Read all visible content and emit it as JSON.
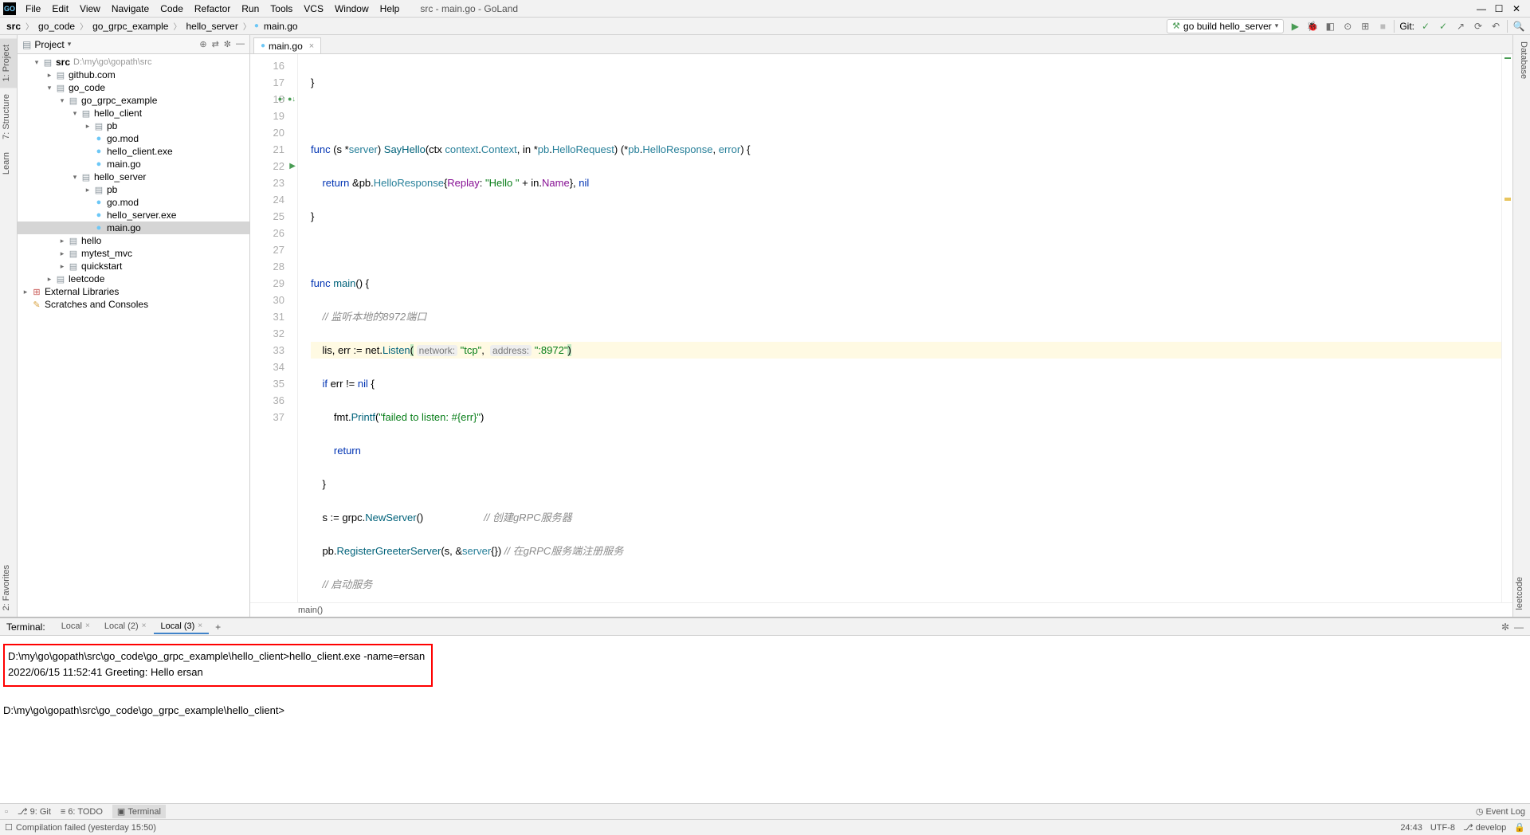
{
  "window": {
    "title": "src - main.go - GoLand"
  },
  "menu": [
    "File",
    "Edit",
    "View",
    "Navigate",
    "Code",
    "Refactor",
    "Run",
    "Tools",
    "VCS",
    "Window",
    "Help"
  ],
  "breadcrumbs": [
    "src",
    "go_code",
    "go_grpc_example",
    "hello_server",
    "main.go"
  ],
  "run_config": {
    "label": "go build hello_server"
  },
  "git_label": "Git:",
  "project": {
    "title": "Project",
    "tree": {
      "root": {
        "label": "src",
        "path": "D:\\my\\go\\gopath\\src"
      },
      "items": [
        {
          "label": "github.com",
          "indent": 2,
          "arrow": "▸",
          "icon": "folder"
        },
        {
          "label": "go_code",
          "indent": 2,
          "arrow": "▾",
          "icon": "folder"
        },
        {
          "label": "go_grpc_example",
          "indent": 3,
          "arrow": "▾",
          "icon": "folder"
        },
        {
          "label": "hello_client",
          "indent": 4,
          "arrow": "▾",
          "icon": "folder"
        },
        {
          "label": "pb",
          "indent": 5,
          "arrow": "▸",
          "icon": "folder"
        },
        {
          "label": "go.mod",
          "indent": 5,
          "arrow": "",
          "icon": "go"
        },
        {
          "label": "hello_client.exe",
          "indent": 5,
          "arrow": "",
          "icon": "go"
        },
        {
          "label": "main.go",
          "indent": 5,
          "arrow": "",
          "icon": "go"
        },
        {
          "label": "hello_server",
          "indent": 4,
          "arrow": "▾",
          "icon": "folder"
        },
        {
          "label": "pb",
          "indent": 5,
          "arrow": "▸",
          "icon": "folder"
        },
        {
          "label": "go.mod",
          "indent": 5,
          "arrow": "",
          "icon": "go"
        },
        {
          "label": "hello_server.exe",
          "indent": 5,
          "arrow": "",
          "icon": "go"
        },
        {
          "label": "main.go",
          "indent": 5,
          "arrow": "",
          "icon": "go",
          "selected": true
        },
        {
          "label": "hello",
          "indent": 3,
          "arrow": "▸",
          "icon": "folder"
        },
        {
          "label": "mytest_mvc",
          "indent": 3,
          "arrow": "▸",
          "icon": "folder"
        },
        {
          "label": "quickstart",
          "indent": 3,
          "arrow": "▸",
          "icon": "folder"
        },
        {
          "label": "leetcode",
          "indent": 2,
          "arrow": "▸",
          "icon": "folder"
        }
      ],
      "external": "External Libraries",
      "scratches": "Scratches and Consoles"
    }
  },
  "editor": {
    "tab": "main.go",
    "breadcrumb": "main()",
    "lines_start": 16,
    "lines_end": 37
  },
  "terminal": {
    "title": "Terminal:",
    "tabs": [
      "Local",
      "Local (2)",
      "Local (3)"
    ],
    "active": 2,
    "line1": "D:\\my\\go\\gopath\\src\\go_code\\go_grpc_example\\hello_client>hello_client.exe -name=ersan",
    "line2": "2022/06/15 11:52:41 Greeting: Hello ersan",
    "line3": "D:\\my\\go\\gopath\\src\\go_code\\go_grpc_example\\hello_client>"
  },
  "bottom_tabs": {
    "git": "9: Git",
    "todo": "6: TODO",
    "terminal": "Terminal",
    "eventlog": "Event Log"
  },
  "status": {
    "text": "Compilation failed (yesterday 15:50)",
    "pos": "24:43",
    "encoding": "UTF-8",
    "branch": "develop"
  },
  "left_strip": [
    "1: Project",
    "7: Structure",
    "Learn"
  ],
  "right_strip_top": "Database",
  "right_strip_bottom": "leetcode",
  "side_bottom": "2: Favorites"
}
